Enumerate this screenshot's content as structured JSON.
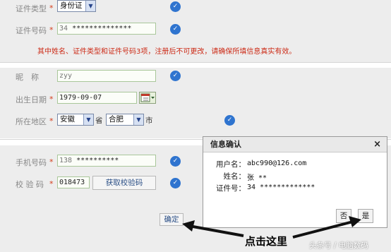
{
  "form": {
    "id_type": {
      "label": "证件类型",
      "value": "身份证"
    },
    "id_number": {
      "label": "证件号码",
      "prefix": "34",
      "masked": "**************"
    },
    "notice": "其中姓名、证件类型和证件号码3项，注册后不可更改，请确保所填信息真实有效。",
    "nickname": {
      "label": "昵　称",
      "value": "zyy"
    },
    "birthdate": {
      "label": "出生日期",
      "value": "1979-09-07"
    },
    "region": {
      "label": "所在地区",
      "province": "安徽",
      "province_unit": "省",
      "city": "合肥",
      "city_unit": "市"
    },
    "phone": {
      "label": "手机号码",
      "prefix": "138",
      "masked": "**********"
    },
    "verify": {
      "label": "校 验 码",
      "value": "018473",
      "get_code_label": "获取校验码"
    },
    "confirm_label": "确定",
    "required_mark": "*"
  },
  "dialog": {
    "title": "信息确认",
    "close": "×",
    "username_label": "用户名：",
    "username": "abc990@126.com",
    "name_label": "姓名：",
    "name": "张 **",
    "id_label": "证件号：",
    "id_value": "34 *************",
    "no_label": "否",
    "yes_label": "是"
  },
  "annotation": {
    "text": "点击这里"
  },
  "watermark": "头条号 / 电脑数码"
}
